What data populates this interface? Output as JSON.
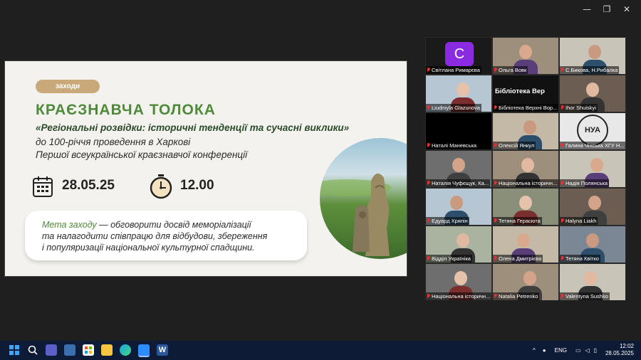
{
  "window_controls": {
    "minimize": "—",
    "restore": "❐",
    "close": "✕"
  },
  "slide": {
    "tag": "заходи",
    "title": "КРАЄЗНАВЧА ТОЛОКА",
    "subtitle_quote": "«Регіональні розвідки: історичні тенденції та сучасні виклики»",
    "subtitle_line2": "до 100-річчя проведення в Харкові",
    "subtitle_line3": "Першої всеукраїнської краєзнавчої конференції",
    "date": "28.05.25",
    "time": "12.00",
    "goal_label": "Мета заходу",
    "goal_text_1": " — обговорити досвід меморіалізації",
    "goal_text_2": "та налагодити співпрацю для відбудови, збереження",
    "goal_text_3": "і популяризації національної культурної спадщини.",
    "colors": {
      "title": "#4f8a3b",
      "tag": "#c9a97a"
    }
  },
  "participants": [
    {
      "name": "Світлана Римарєва",
      "avatar_letter": "С",
      "avatar_color": "#8a2be2"
    },
    {
      "name": "Ольга Вовк"
    },
    {
      "name": "С.Бикова, Н.Рибалка"
    },
    {
      "name": "Liudmyla Glazunova",
      "active": true
    },
    {
      "name": "Бібліотека Верхні Вор...",
      "banner": "Бібліотека Вер"
    },
    {
      "name": "Ihor Shuiskyi"
    },
    {
      "name": "Наталі Маневська"
    },
    {
      "name": "Олексій Янкул"
    },
    {
      "name": "Галина Чінська ХГУ Н...",
      "logo": "НУА"
    },
    {
      "name": "Наталія Чуфєщук, Ка..."
    },
    {
      "name": "Національна історичн..."
    },
    {
      "name": "Надія Полянська"
    },
    {
      "name": "Едуард Хряпін"
    },
    {
      "name": "Тетяна Герасюта"
    },
    {
      "name": "Halyna Liakh"
    },
    {
      "name": "Відділ Українікa"
    },
    {
      "name": "Олена Дмитрієва"
    },
    {
      "name": "Тетяна Квітко"
    },
    {
      "name": "Національна історичн..."
    },
    {
      "name": "Natalia Petrenko"
    },
    {
      "name": "Valentyna Sushko"
    }
  ],
  "taskbar": {
    "apps": [
      "windows-start",
      "search",
      "meet",
      "notes",
      "store",
      "explorer",
      "edge",
      "zoom",
      "word"
    ],
    "lang": "ENG",
    "time": "12:02",
    "date": "28.05.2025"
  }
}
